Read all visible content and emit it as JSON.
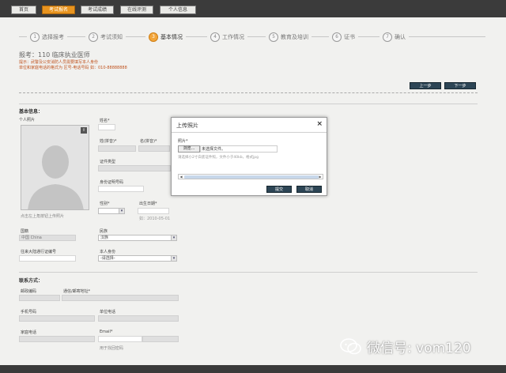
{
  "nav": {
    "tabs": [
      {
        "label": "首页",
        "active": false
      },
      {
        "label": "考试报名",
        "active": true
      },
      {
        "label": "考试成绩",
        "active": false
      },
      {
        "label": "在线评测",
        "active": false
      },
      {
        "label": "个人信息",
        "active": false
      }
    ]
  },
  "steps": [
    {
      "num": "1",
      "label": "选择报考",
      "active": false
    },
    {
      "num": "2",
      "label": "考试须知",
      "active": false
    },
    {
      "num": "3",
      "label": "基本情况",
      "active": true
    },
    {
      "num": "4",
      "label": "工作情况",
      "active": false
    },
    {
      "num": "5",
      "label": "教育及培训",
      "active": false
    },
    {
      "num": "6",
      "label": "证书",
      "active": false
    },
    {
      "num": "7",
      "label": "确认",
      "active": false
    }
  ],
  "header": {
    "exam_title": "报考：110 临床执业医师",
    "notice_line1": "提示：武警及公安消防人员需要填写本人身份",
    "notice_line2": "单位和家庭电话的格式为 区号-电话号码 如：010-88888888",
    "prev_label": "上一步",
    "next_label": "下一步"
  },
  "basic": {
    "section_title": "基本信息：",
    "photo_label": "个人照片",
    "photo_hint": "点击左上角按钮上传照片",
    "name_label": "姓名*",
    "surname_pinyin_label": "姓(拼音)*",
    "given_pinyin_label": "名(拼音)*",
    "id_type_label": "证件类型",
    "id_number_label": "身份证明号码",
    "gender_label": "性别*",
    "birth_label": "出生日期*",
    "birth_hint": "如：2010-05-01",
    "country_label": "国籍",
    "country_value": "中国 China",
    "ethnicity_label": "民族",
    "ethnicity_value": "汉族",
    "permit_label": "往来大陆通行证编号",
    "identity_label": "本人身份",
    "identity_value": "-请选择-"
  },
  "contact": {
    "section_title": "联系方式：",
    "postcode_label": "邮政编码",
    "address_label": "通信/邮寄地址*",
    "mobile_label": "手机号码",
    "work_phone_label": "单位电话",
    "home_phone_label": "家庭电话",
    "email_label": "Email*",
    "email_hint": "用于找回密码"
  },
  "modal": {
    "title": "上传照片",
    "close": "×",
    "photo_label": "照片*",
    "browse_label": "浏览...",
    "file_status": "未选择文件。",
    "hint": "请选择小2寸白底证件照，文件小于40kb，格式jpg",
    "submit_label": "提交",
    "cancel_label": "取消",
    "scroll_left": "◀",
    "scroll_right": "▶"
  },
  "watermark": {
    "text": "微信号: vom120"
  },
  "colors": {
    "accent": "#e8941f",
    "dark_button": "#2d4555",
    "notice": "#c0531f"
  }
}
